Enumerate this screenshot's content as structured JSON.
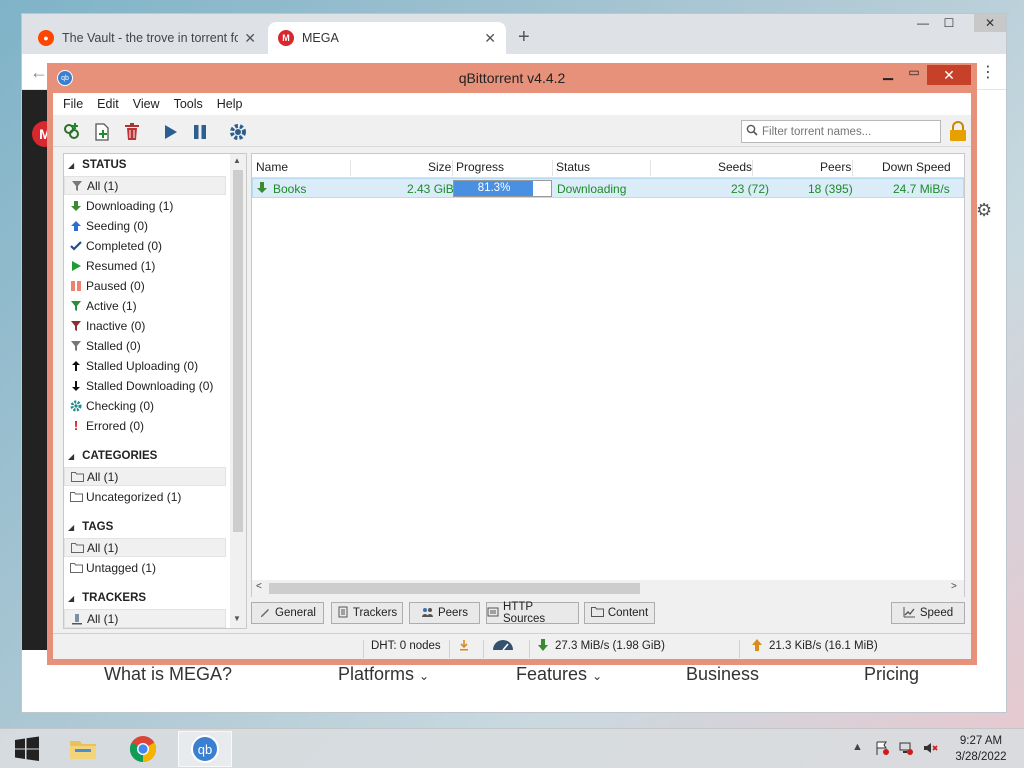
{
  "browser": {
    "tabs": [
      {
        "label": "The Vault - the trove in torrent fo",
        "active": false
      },
      {
        "label": "MEGA",
        "active": true
      }
    ],
    "new_tab": "+",
    "window_controls": {
      "minimize": "—",
      "maximize": "☐",
      "close": "✕"
    }
  },
  "mega": {
    "logo": "M",
    "nav": [
      "What is MEGA?",
      "Platforms",
      "Features",
      "Business",
      "Pricing"
    ]
  },
  "qbt": {
    "title": "qBittorrent v4.4.2",
    "app_icon": "qb",
    "menu": [
      "File",
      "Edit",
      "View",
      "Tools",
      "Help"
    ],
    "search": {
      "placeholder": "Filter torrent names..."
    },
    "sidebar": {
      "status_header": "STATUS",
      "status": [
        {
          "label": "All (1)",
          "icon": "filter-icon",
          "color": "#777777"
        },
        {
          "label": "Downloading (1)",
          "icon": "download-arrow-icon",
          "color": "#3a8a2f"
        },
        {
          "label": "Seeding (0)",
          "icon": "upload-arrow-icon",
          "color": "#2d6fd0"
        },
        {
          "label": "Completed (0)",
          "icon": "check-icon",
          "color": "#1f4e8c"
        },
        {
          "label": "Resumed (1)",
          "icon": "play-icon",
          "color": "#1f9a35"
        },
        {
          "label": "Paused (0)",
          "icon": "pause-icon",
          "color": "#f08070"
        },
        {
          "label": "Active (1)",
          "icon": "active-filter-icon",
          "color": "#2e8b3a"
        },
        {
          "label": "Inactive (0)",
          "icon": "inactive-filter-icon",
          "color": "#8a3030"
        },
        {
          "label": "Stalled (0)",
          "icon": "stalled-filter-icon",
          "color": "#777777"
        },
        {
          "label": "Stalled Uploading (0)",
          "icon": "stalled-up-icon",
          "color": "#111111"
        },
        {
          "label": "Stalled Downloading (0)",
          "icon": "stalled-down-icon",
          "color": "#111111"
        },
        {
          "label": "Checking (0)",
          "icon": "checking-gear-icon",
          "color": "#1e8a8a"
        },
        {
          "label": "Errored (0)",
          "icon": "error-icon",
          "color": "#d11a1a"
        }
      ],
      "categories_header": "CATEGORIES",
      "categories": [
        "All (1)",
        "Uncategorized (1)"
      ],
      "tags_header": "TAGS",
      "tags": [
        "All (1)",
        "Untagged (1)"
      ],
      "trackers_header": "TRACKERS",
      "trackers": [
        "All (1)"
      ]
    },
    "columns": {
      "name": "Name",
      "size": "Size",
      "progress": "Progress",
      "status": "Status",
      "seeds": "Seeds",
      "peers": "Peers",
      "down_speed": "Down Speed"
    },
    "torrents": [
      {
        "name": "Books",
        "size": "2.43 GiB",
        "progress_text": "81.3%",
        "progress": 0.813,
        "status": "Downloading",
        "seeds": "23 (72)",
        "peers": "18 (395)",
        "down_speed": "24.7 MiB/s"
      }
    ],
    "bottom_tabs": [
      "General",
      "Trackers",
      "Peers",
      "HTTP Sources",
      "Content"
    ],
    "speed_button": "Speed",
    "status_bar": {
      "dht": "DHT: 0 nodes",
      "download": "27.3 MiB/s (1.98 GiB)",
      "upload": "21.3 KiB/s (16.1 MiB)"
    }
  },
  "taskbar": {
    "time": "9:27 AM",
    "date": "3/28/2022",
    "qb_label": "qb"
  },
  "colors": {
    "qbt_titlebar": "#e8917a",
    "qbt_close": "#c7402a",
    "progress_fill": "#4a90e2",
    "downloading_text": "#1f8a2a",
    "selected_row": "#d9ecf8"
  }
}
